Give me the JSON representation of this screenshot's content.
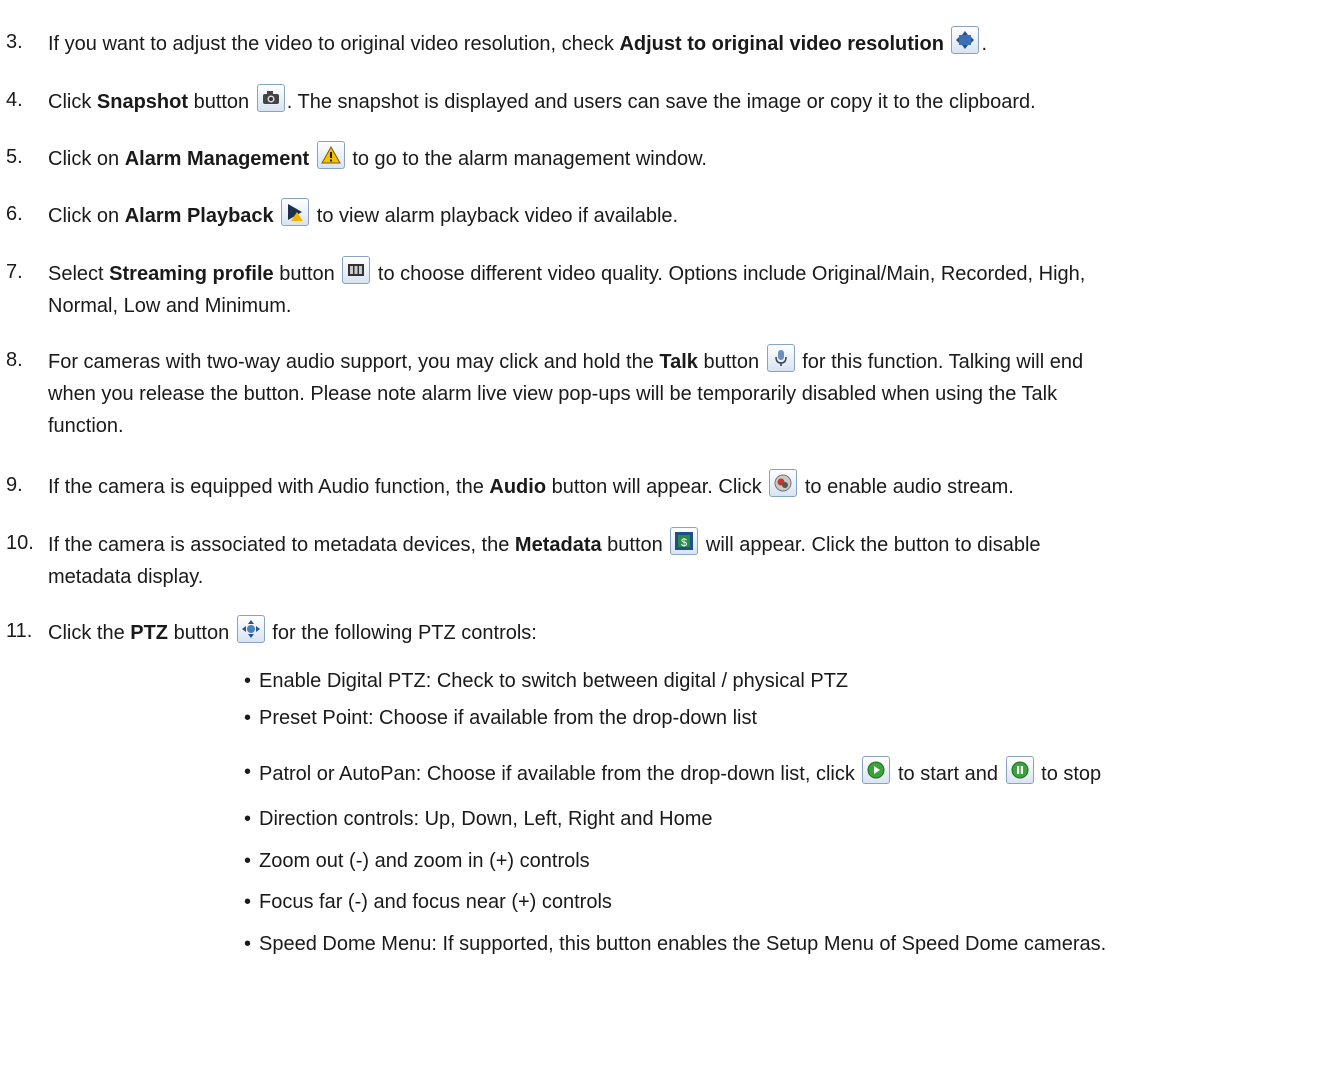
{
  "steps": [
    {
      "num": "3.",
      "pre": "If you want to adjust the video to original video resolution, check ",
      "bold": "Adjust to original video resolution",
      "icon": "adjust-resolution-icon",
      "post": "."
    },
    {
      "num": "4.",
      "pre": "Click ",
      "bold": "Snapshot",
      "mid": " button ",
      "icon": "camera-icon",
      "post": ". The snapshot is displayed and users can save the image or copy it to the clipboard."
    },
    {
      "num": "5.",
      "pre": "Click on ",
      "bold": "Alarm Management",
      "icon": "alarm-warning-icon",
      "post": " to go to the alarm management window."
    },
    {
      "num": "6.",
      "pre": "Click on ",
      "bold": "Alarm Playback",
      "icon": "alarm-playback-icon",
      "post": " to view alarm playback video if available."
    },
    {
      "num": "7.",
      "pre": "Select ",
      "bold": "Streaming profile",
      "mid": " button ",
      "icon": "film-strip-icon",
      "post": " to choose different video quality.  Options include Original/Main, Recorded, High,",
      "line2": "Normal, Low and Minimum."
    },
    {
      "num": "8.",
      "pre": "For cameras with two-way audio support, you may click and hold the ",
      "bold": "Talk",
      "mid": " button ",
      "icon": "microphone-icon",
      "post": " for this function.  Talking will end",
      "line2": "when you release the button.  Please note alarm live view pop-ups will be temporarily disabled when using the Talk",
      "line3": "function."
    },
    {
      "num": "9.",
      "pre": "If the camera is equipped with Audio function, the ",
      "bold": "Audio",
      "mid": " button will appear. Click ",
      "icon": "audio-icon",
      "post": " to enable audio stream."
    },
    {
      "num": "10.",
      "pre": "If the camera is associated to metadata devices, the ",
      "bold": "Metadata",
      "mid": " button ",
      "icon": "metadata-icon",
      "post": " will appear. Click the button to disable",
      "line2": "metadata display."
    },
    {
      "num": "11.",
      "pre": "Click the ",
      "bold": "PTZ",
      "mid": " button ",
      "icon": "ptz-icon",
      "post": " for the following PTZ controls:"
    }
  ],
  "bullets": [
    "Enable Digital PTZ: Check to switch between digital / physical PTZ",
    "Preset Point: Choose if available from the drop-down list",
    {
      "pre": "Patrol or AutoPan: Choose if available from the drop-down list, click ",
      "icon1": "play-icon",
      "mid": " to start and ",
      "icon2": "pause-icon",
      "post": " to stop"
    },
    "Direction controls: Up, Down, Left, Right and Home",
    "Zoom out (-) and zoom in (+) controls",
    "Focus far (-) and focus near (+) controls",
    "Speed Dome Menu: If supported, this button enables the Setup Menu of Speed Dome cameras."
  ],
  "bullet_char": "•"
}
